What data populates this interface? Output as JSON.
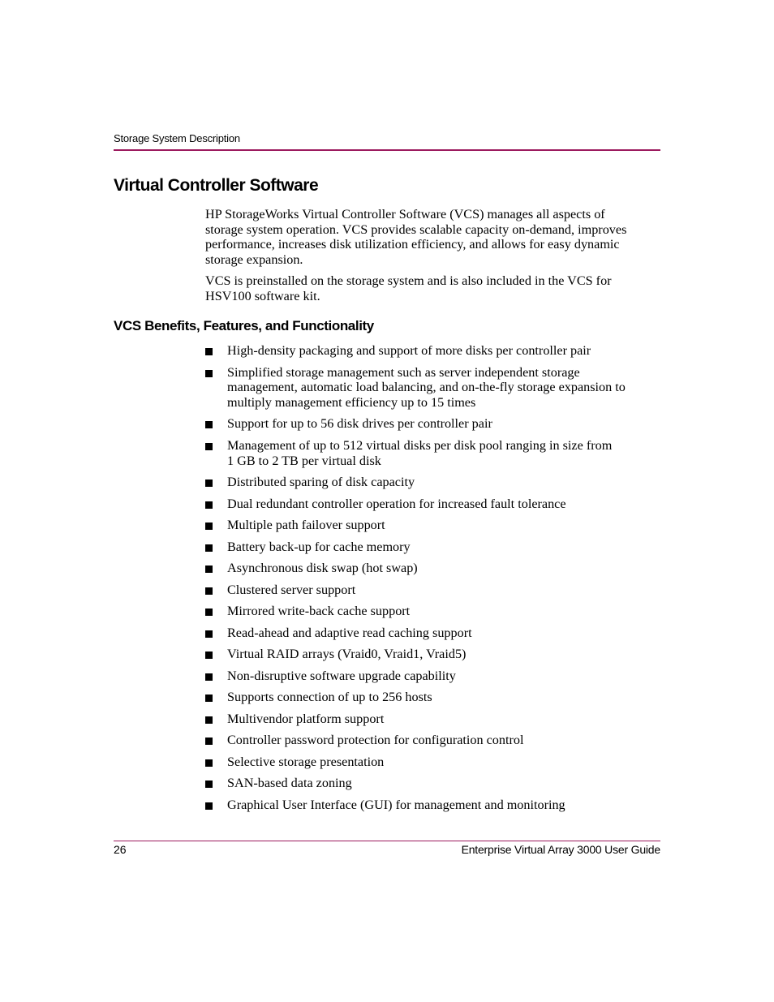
{
  "header": {
    "running_head": "Storage System Description",
    "rule_color": "#9c1a5e"
  },
  "section": {
    "title": "Virtual Controller Software",
    "paragraphs": [
      {
        "lines": [
          "HP StorageWorks Virtual Controller Software (VCS) manages all aspects of",
          "storage system operation. VCS provides scalable capacity on-demand, improves",
          "performance, increases disk utilization efficiency, and allows for easy dynamic",
          "storage expansion."
        ]
      },
      {
        "lines": [
          "VCS is preinstalled on the storage system and is also included in the VCS for",
          "HSV100 software kit."
        ]
      }
    ]
  },
  "subsection": {
    "title": "VCS Benefits, Features, and Functionality",
    "bullet_icon": "square-bullet-icon",
    "items": [
      {
        "lines": [
          "High-density packaging and support of more disks per controller pair"
        ]
      },
      {
        "lines": [
          "Simplified storage management such as server independent storage",
          "management, automatic load balancing, and on-the-fly storage expansion to",
          "multiply management efficiency up to 15 times"
        ]
      },
      {
        "lines": [
          "Support for up to 56 disk drives per controller pair"
        ]
      },
      {
        "lines": [
          "Management of up to 512 virtual disks per disk pool ranging in size from",
          "1 GB to 2 TB per virtual disk"
        ]
      },
      {
        "lines": [
          "Distributed sparing of disk capacity"
        ]
      },
      {
        "lines": [
          "Dual redundant controller operation for increased fault tolerance"
        ]
      },
      {
        "lines": [
          "Multiple path failover support"
        ]
      },
      {
        "lines": [
          "Battery back-up for cache memory"
        ]
      },
      {
        "lines": [
          "Asynchronous disk swap (hot swap)"
        ]
      },
      {
        "lines": [
          "Clustered server support"
        ]
      },
      {
        "lines": [
          "Mirrored write-back cache support"
        ]
      },
      {
        "lines": [
          "Read-ahead and adaptive read caching support"
        ]
      },
      {
        "lines": [
          "Virtual RAID arrays (Vraid0, Vraid1, Vraid5)"
        ]
      },
      {
        "lines": [
          "Non-disruptive software upgrade capability"
        ]
      },
      {
        "lines": [
          "Supports connection of up to 256 hosts"
        ]
      },
      {
        "lines": [
          "Multivendor platform support"
        ]
      },
      {
        "lines": [
          "Controller password protection for configuration control"
        ]
      },
      {
        "lines": [
          "Selective storage presentation"
        ]
      },
      {
        "lines": [
          "SAN-based data zoning"
        ]
      },
      {
        "lines": [
          "Graphical User Interface (GUI) for management and monitoring"
        ]
      }
    ]
  },
  "footer": {
    "page_number": "26",
    "document_title": "Enterprise Virtual Array 3000 User Guide"
  }
}
